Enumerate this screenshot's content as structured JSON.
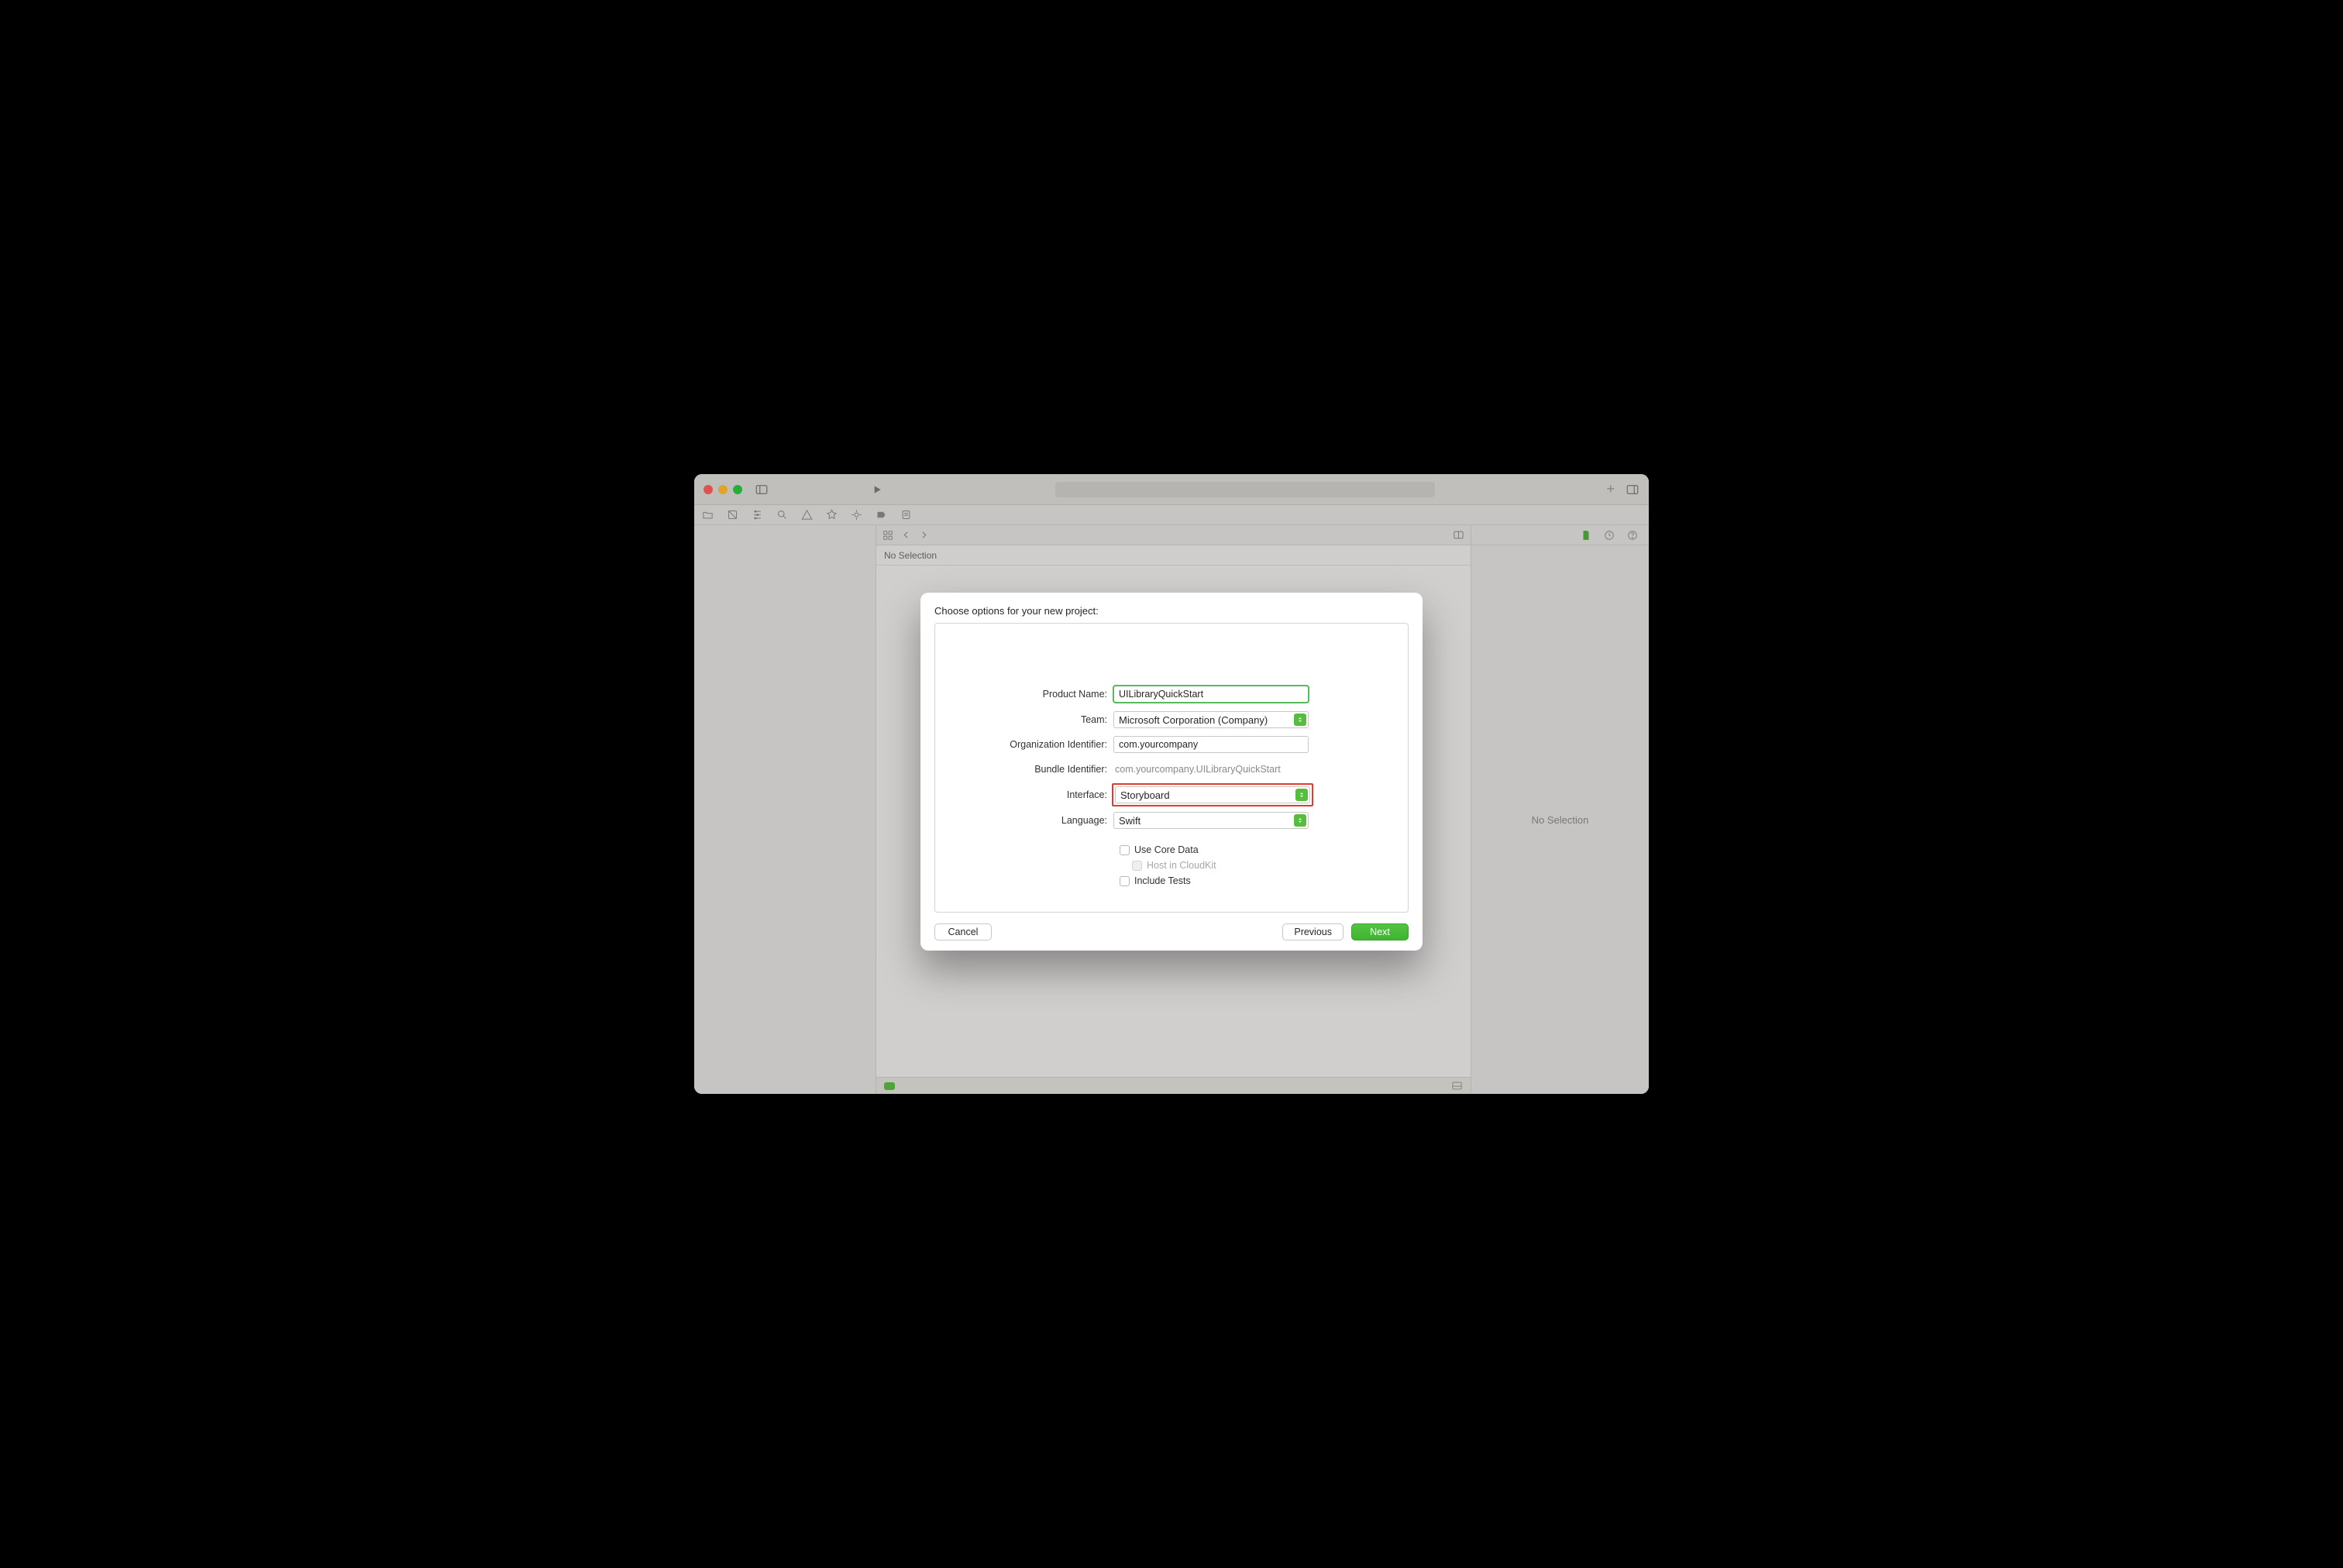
{
  "window": {
    "no_selection": "No Selection"
  },
  "inspector": {
    "no_selection": "No Selection"
  },
  "sheet": {
    "title": "Choose options for your new project:",
    "labels": {
      "product": "Product Name:",
      "team": "Team:",
      "org": "Organization Identifier:",
      "bundle": "Bundle Identifier:",
      "interface": "Interface:",
      "language": "Language:"
    },
    "values": {
      "product": "UILibraryQuickStart",
      "team": "Microsoft Corporation (Company)",
      "org": "com.yourcompany",
      "bundle": "com.yourcompany.UILibraryQuickStart",
      "interface": "Storyboard",
      "language": "Swift"
    },
    "checkboxes": {
      "core_data": "Use Core Data",
      "cloudkit": "Host in CloudKit",
      "tests": "Include Tests"
    },
    "buttons": {
      "cancel": "Cancel",
      "previous": "Previous",
      "next": "Next"
    }
  }
}
